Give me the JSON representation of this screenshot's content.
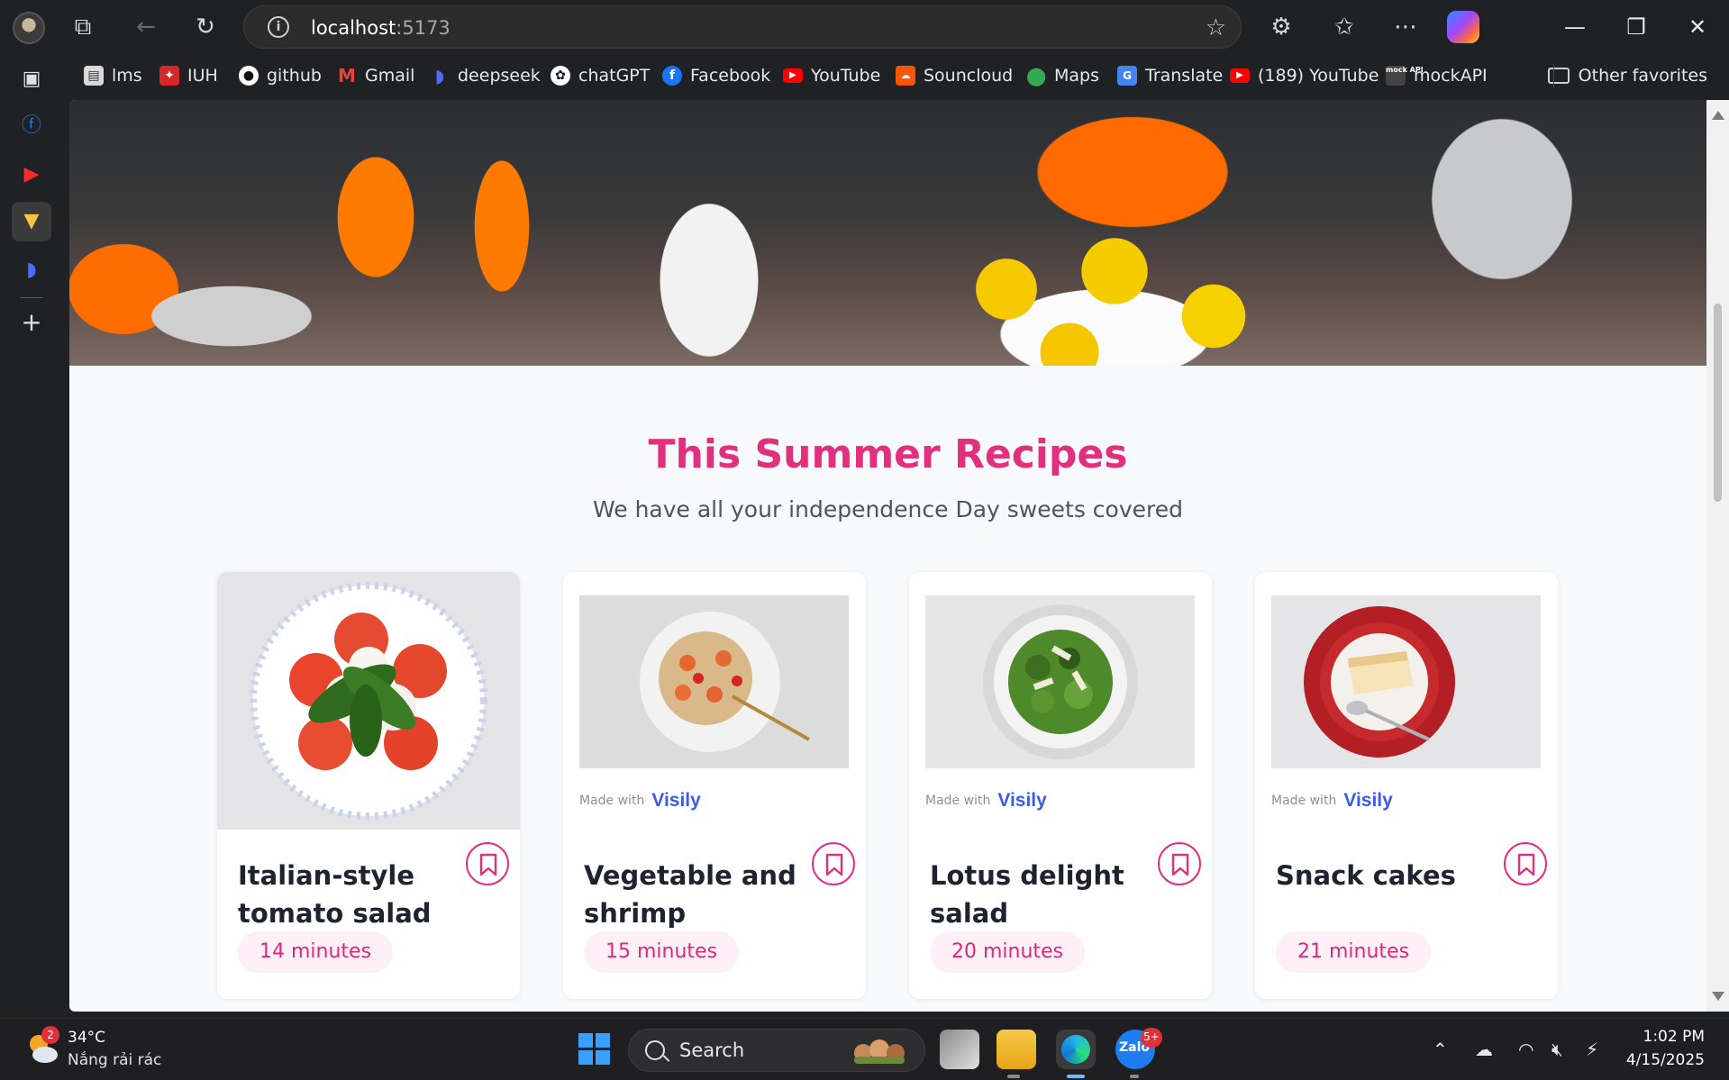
{
  "browser": {
    "url_host": "localhost",
    "url_port": ":5173"
  },
  "bookmarks": [
    {
      "label": "lms",
      "icon": "lms-icon",
      "color": "#d9d9d9"
    },
    {
      "label": "IUH",
      "icon": "iuh-icon",
      "color": "#d62828"
    },
    {
      "label": "github",
      "icon": "github-icon",
      "color": "#ffffff"
    },
    {
      "label": "Gmail",
      "icon": "gmail-icon",
      "color": "#ea4335"
    },
    {
      "label": "deepseek",
      "icon": "deepseek-icon",
      "color": "#4d6bfe"
    },
    {
      "label": "chatGPT",
      "icon": "chatgpt-icon",
      "color": "#ffffff"
    },
    {
      "label": "Facebook",
      "icon": "facebook-icon",
      "color": "#1877f2"
    },
    {
      "label": "YouTube",
      "icon": "youtube-icon",
      "color": "#ff0000"
    },
    {
      "label": "Souncloud",
      "icon": "soundcloud-icon",
      "color": "#ff5500"
    },
    {
      "label": "Maps",
      "icon": "maps-icon",
      "color": "#34a853"
    },
    {
      "label": "Translate",
      "icon": "translate-icon",
      "color": "#4285f4"
    },
    {
      "label": "(189) YouTube",
      "icon": "youtube-icon",
      "color": "#ff0000"
    },
    {
      "label": "mockAPI",
      "icon": "mockapi-icon",
      "color": "#555555"
    }
  ],
  "other_favorites": "Other favorites",
  "section": {
    "title": "This Summer Recipes",
    "subtitle": "We have all your independence Day sweets covered"
  },
  "cards": [
    {
      "title": "Italian-style tomato salad",
      "time": "14 minutes",
      "made_with": "",
      "brand": ""
    },
    {
      "title": "Vegetable and shrimp spaghetti",
      "time": "15 minutes",
      "made_with": "Made with",
      "brand": "Visily"
    },
    {
      "title": "Lotus delight salad",
      "time": "20 minutes",
      "made_with": "Made with",
      "brand": "Visily"
    },
    {
      "title": "Snack cakes",
      "time": "21 minutes",
      "made_with": "Made with",
      "brand": "Visily"
    }
  ],
  "taskbar": {
    "weather_badge": "2",
    "temperature": "34°C",
    "weather_desc": "Nắng rải rác",
    "search_label": "Search",
    "zalo_badge": "5+",
    "time": "1:02 PM",
    "date": "4/15/2025"
  },
  "colors": {
    "accent": "#e2307f",
    "pill_bg": "#fdf0f6",
    "page_bg": "#f8f9fb"
  }
}
